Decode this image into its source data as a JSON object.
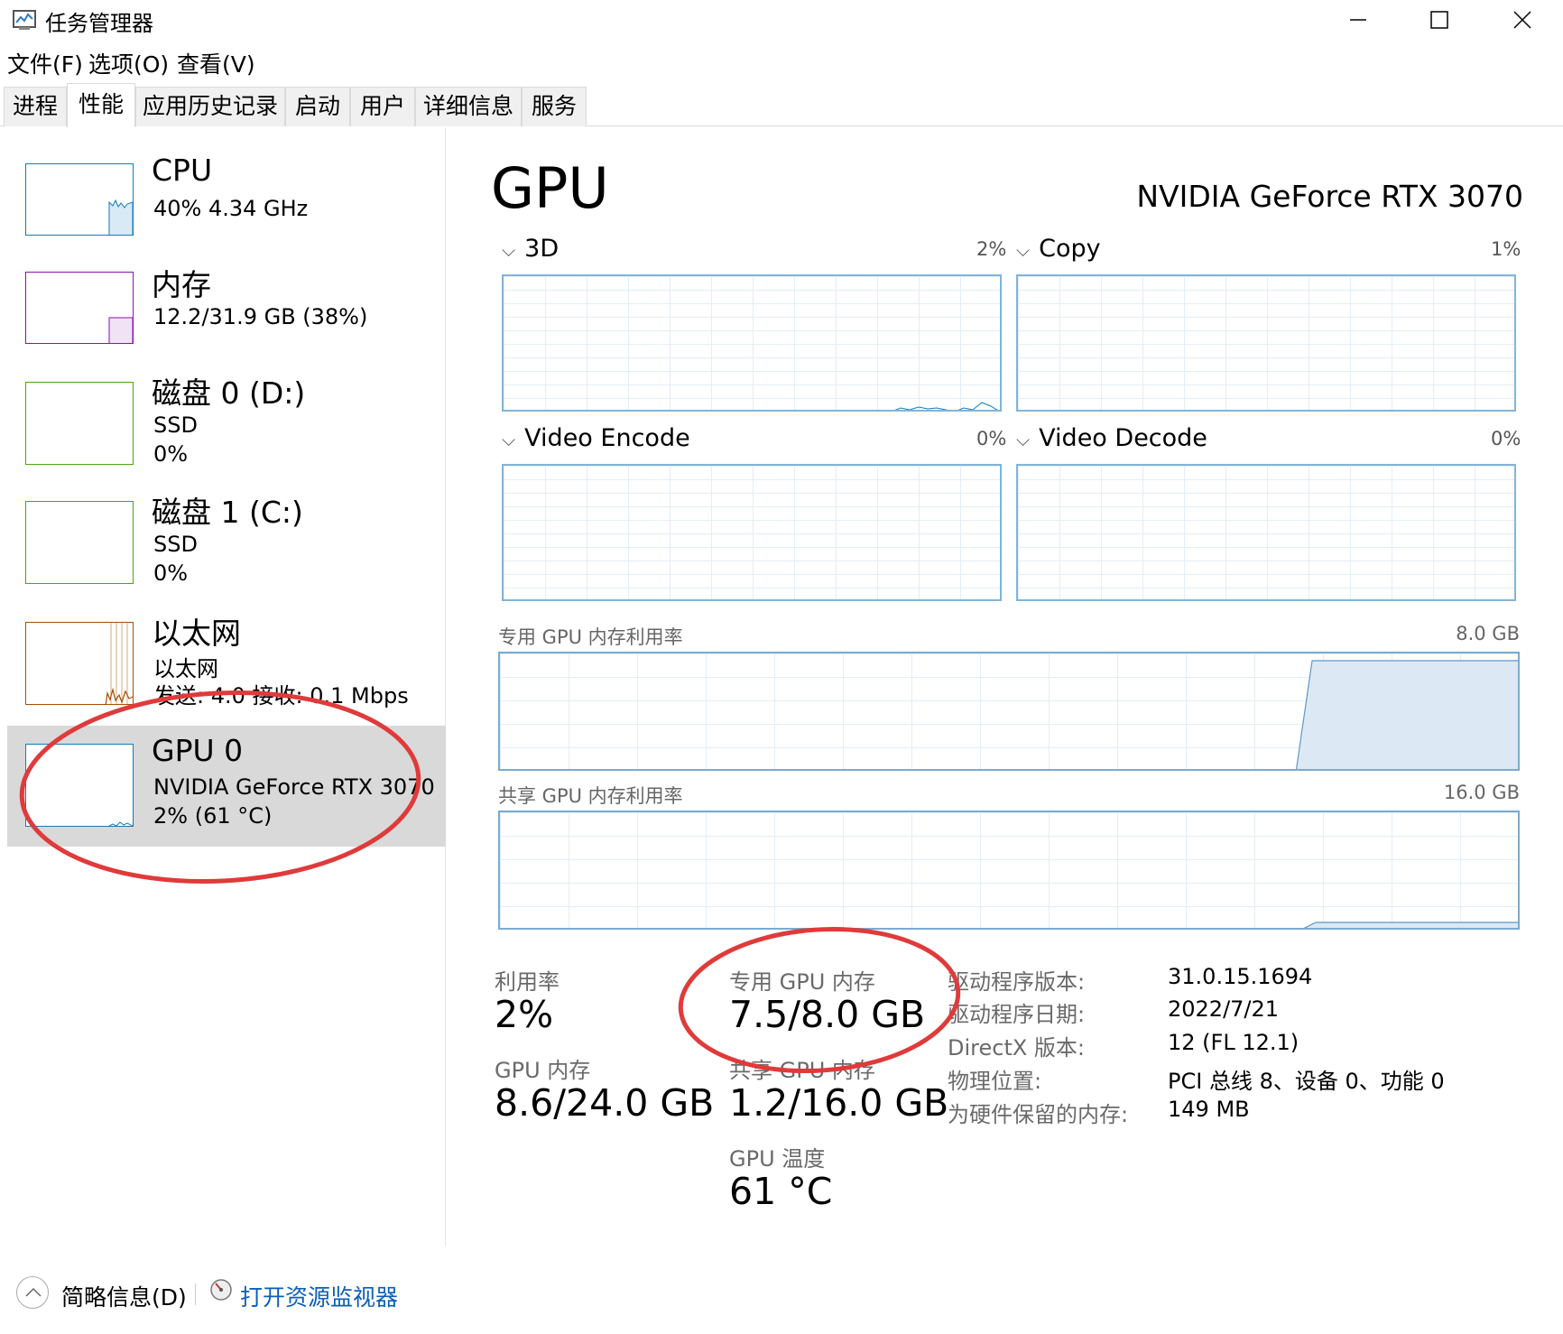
{
  "window": {
    "title": "任务管理器"
  },
  "menu": [
    "文件(F)",
    "选项(O)",
    "查看(V)"
  ],
  "tabs": [
    "进程",
    "性能",
    "应用历史记录",
    "启动",
    "用户",
    "详细信息",
    "服务"
  ],
  "active_tab": "性能",
  "sidebar": [
    {
      "name": "CPU",
      "lines": [
        "40%  4.34 GHz"
      ],
      "color": "#117dbb"
    },
    {
      "name": "内存",
      "lines": [
        "12.2/31.9 GB (38%)"
      ],
      "color": "#8b12ae"
    },
    {
      "name": "磁盘 0 (D:)",
      "lines": [
        "SSD",
        "0%"
      ],
      "color": "#4da60c"
    },
    {
      "name": "磁盘 1 (C:)",
      "lines": [
        "SSD",
        "0%"
      ],
      "color": "#4da60c"
    },
    {
      "name": "以太网",
      "lines": [
        "以太网",
        "发送: 4.0  接收: 0.1 Mbps"
      ],
      "color": "#a74f01"
    },
    {
      "name": "GPU 0",
      "lines": [
        "NVIDIA GeForce RTX 3070",
        "2% (61 °C)"
      ],
      "color": "#117dbb",
      "selected": true
    }
  ],
  "gpu": {
    "title": "GPU",
    "model": "NVIDIA GeForce RTX 3070",
    "engines": [
      {
        "label": "3D",
        "percent": "2%"
      },
      {
        "label": "Copy",
        "percent": "1%"
      },
      {
        "label": "Video Encode",
        "percent": "0%"
      },
      {
        "label": "Video Decode",
        "percent": "0%"
      }
    ],
    "dedicated_chart": {
      "label": "专用 GPU 内存利用率",
      "max": "8.0 GB"
    },
    "shared_chart": {
      "label": "共享 GPU 内存利用率",
      "max": "16.0 GB"
    },
    "stats": {
      "utilization_label": "利用率",
      "utilization": "2%",
      "dedicated_label": "专用 GPU 内存",
      "dedicated": "7.5/8.0 GB",
      "gpu_mem_label": "GPU 内存",
      "gpu_mem": "8.6/24.0 GB",
      "shared_label": "共享 GPU 内存",
      "shared": "1.2/16.0 GB",
      "temp_label": "GPU 温度",
      "temp": "61 °C"
    },
    "info": [
      {
        "label": "驱动程序版本:",
        "value": "31.0.15.1694"
      },
      {
        "label": "驱动程序日期:",
        "value": "2022/7/21"
      },
      {
        "label": "DirectX 版本:",
        "value": "12 (FL 12.1)"
      },
      {
        "label": "物理位置:",
        "value": "PCI 总线 8、设备 0、功能 0"
      },
      {
        "label": "为硬件保留的内存:",
        "value": "149 MB"
      }
    ]
  },
  "footer": {
    "fewer_details": "简略信息(D)",
    "open_monitor": "打开资源监视器"
  },
  "colors": {
    "gpu_border": "#82b4d8",
    "link": "#0b5fb8",
    "annotation": "#e03a3a"
  },
  "icons": [
    "task-manager-icon",
    "minimize-icon",
    "maximize-icon",
    "close-icon",
    "chevron-down-icon",
    "chevron-up-icon",
    "resource-monitor-icon"
  ]
}
